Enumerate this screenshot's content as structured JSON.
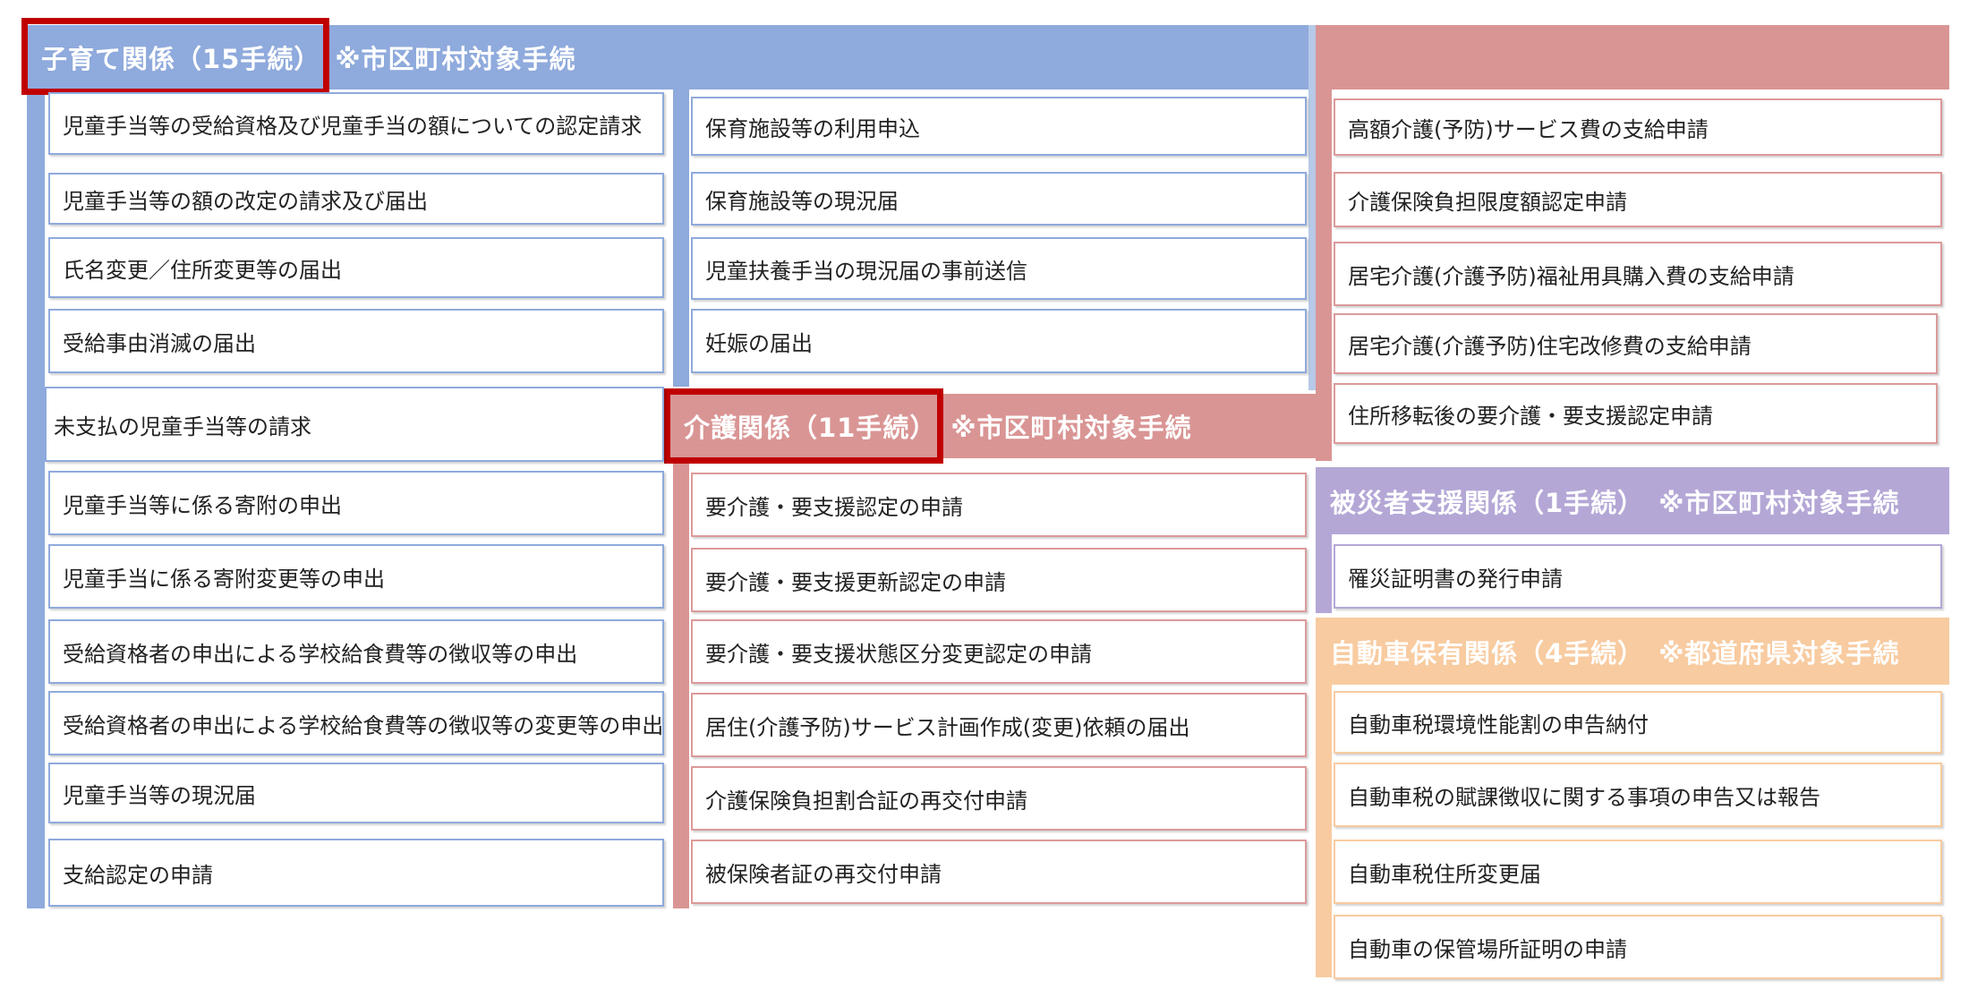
{
  "colors": {
    "blue": "#8faadc",
    "pink": "#d99594",
    "purple": "#b4a7d6",
    "orange": "#f8cba0",
    "highlight": "#c00000"
  },
  "sections": {
    "kosodate": {
      "title": "子育て関係（15手続）",
      "note": "※市区町村対象手続",
      "items_col1": [
        "児童手当等の受給資格及び児童手当の額についての認定請求",
        "児童手当等の額の改定の請求及び届出",
        "氏名変更／住所変更等の届出",
        "受給事由消滅の届出",
        "未支払の児童手当等の請求",
        "児童手当等に係る寄附の申出",
        "児童手当に係る寄附変更等の申出",
        "受給資格者の申出による学校給食費等の徴収等の申出",
        "受給資格者の申出による学校給食費等の徴収等の変更等の申出",
        "児童手当等の現況届",
        "支給認定の申請"
      ],
      "items_col2": [
        "保育施設等の利用申込",
        "保育施設等の現況届",
        "児童扶養手当の現況届の事前送信",
        "妊娠の届出"
      ]
    },
    "kaigo": {
      "title": "介護関係（11手続）",
      "note": "※市区町村対象手続",
      "items_top": [
        "高額介護(予防)サービス費の支給申請",
        "介護保険負担限度額認定申請",
        "居宅介護(介護予防)福祉用具購入費の支給申請",
        "居宅介護(介護予防)住宅改修費の支給申請",
        "住所移転後の要介護・要支援認定申請"
      ],
      "items_bottom": [
        "要介護・要支援認定の申請",
        "要介護・要支援更新認定の申請",
        "要介護・要支援状態区分変更認定の申請",
        "居住(介護予防)サービス計画作成(変更)依頼の届出",
        "介護保険負担割合証の再交付申請",
        "被保険者証の再交付申請"
      ]
    },
    "hisai": {
      "title": "被災者支援関係（1手続）",
      "note": "※市区町村対象手続",
      "items": [
        "罹災証明書の発行申請"
      ]
    },
    "jidosha": {
      "title": "自動車保有関係（4手続）",
      "note": "※都道府県対象手続",
      "items": [
        "自動車税環境性能割の申告納付",
        "自動車税の賦課徴収に関する事項の申告又は報告",
        "自動車税住所変更届",
        "自動車の保管場所証明の申請"
      ]
    }
  }
}
